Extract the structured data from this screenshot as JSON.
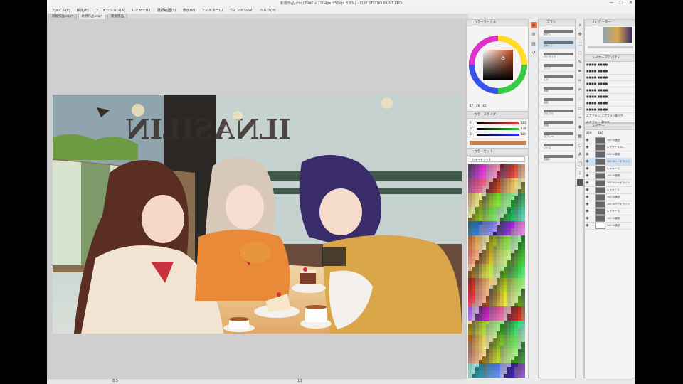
{
  "window": {
    "title": "新規作品.clip (3946 x 2304px 350dpi 8.5%) - CLIP STUDIO PAINT PRO",
    "min": "—",
    "max": "□",
    "close": "✕"
  },
  "menu": [
    "ファイル(F)",
    "編集(E)",
    "アニメーション(A)",
    "レイヤー(L)",
    "選択範囲(S)",
    "表示(V)",
    "フィルター(I)",
    "ウィンドウ(W)",
    "ヘルプ(H)"
  ],
  "tabs": [
    {
      "label": "新規作品.clip*",
      "active": false
    },
    {
      "label": "新規作品.clip*",
      "active": true
    },
    {
      "label": "新規作品",
      "active": false
    }
  ],
  "artwork": {
    "sign_text": "ILNASILIN"
  },
  "status": {
    "zoom": "8.5",
    "coord": "10"
  },
  "color_panel": {
    "header": "カラーサークル",
    "values": [
      "17",
      "26",
      "41"
    ]
  },
  "color_slider_panel": {
    "header": "カラースライダー",
    "rows": [
      {
        "label": "R",
        "value": "182",
        "color": "#d44"
      },
      {
        "label": "G",
        "value": "128",
        "color": "#4a4"
      },
      {
        "label": "B",
        "value": "100",
        "color": "#44d"
      }
    ]
  },
  "color_set": {
    "header": "カラーセット",
    "dropdown": "カラーセット2"
  },
  "brush_panel": {
    "header": "ブラシ",
    "items": [
      "ぼかし",
      "ぼかし2",
      "ハイライト",
      "グラデ",
      "ムラ",
      "水彩",
      "油彩",
      "さらさら",
      "質感",
      "スプレー",
      "ノイズ",
      "質感2"
    ]
  },
  "navigator": {
    "header": "ナビゲーター"
  },
  "properties": {
    "header": "レイヤープロパティ",
    "rows": [
      "■■■■ ■■■■",
      "■■■■ ■■■■",
      "■■■■ ■■■■",
      "■■■■ ■■■■",
      "■■■■ ■■■■",
      "■■■■ ■■■■",
      "■■■■ ■■■■",
      "■■■■ ■■■■",
      "エアブラシ: エアブラシ柔らか",
      "エアブラシ: 軟らか"
    ]
  },
  "layer_panel": {
    "header": "レイヤー",
    "blend": "通常",
    "opacity": "100",
    "layers": [
      "100 %通常",
      "レイヤー 8 の...",
      "100 %通常",
      "100 %ハードライト",
      "レイヤー 1",
      "100 %通常",
      "100 %ハードライト",
      "レイヤー 2",
      "100 %通常",
      "100 %ハードライト",
      "レイヤー 3",
      "100 %通常",
      "100 %通常"
    ]
  },
  "colors": {
    "titlebar": "#f4f4f4",
    "canvas_bg": "#cfcfcf",
    "panel_bg": "#f3f3f3",
    "selection": "#cfe0f0"
  }
}
